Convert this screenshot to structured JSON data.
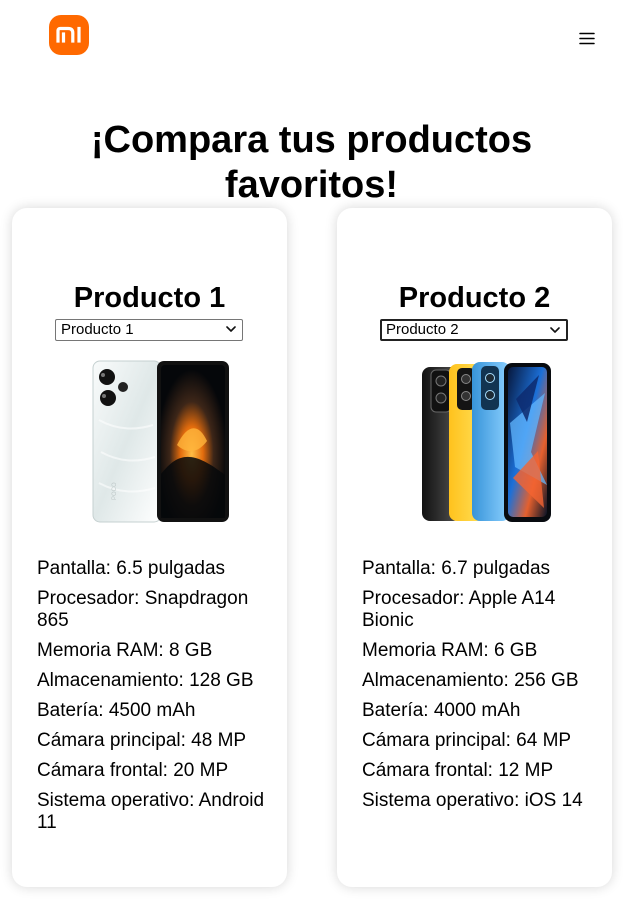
{
  "brand": {
    "logo_text": "mi",
    "menu_icon": "hamburger-menu-icon"
  },
  "page": {
    "title": "¡Compara tus productos favoritos!"
  },
  "products": [
    {
      "title": "Producto 1",
      "selected_option": "Producto 1",
      "image_name": "white-smartphone-image",
      "specs": [
        "Pantalla: 6.5 pulgadas",
        "Procesador: Snapdragon 865",
        "Memoria RAM: 8 GB",
        "Almacenamiento: 128 GB",
        "Batería: 4500 mAh",
        "Cámara principal: 48 MP",
        "Cámara frontal: 20 MP",
        "Sistema operativo: Android 11"
      ]
    },
    {
      "title": "Producto 2",
      "selected_option": "Producto 2",
      "image_name": "colorful-smartphones-image",
      "specs": [
        "Pantalla: 6.7 pulgadas",
        "Procesador: Apple A14 Bionic",
        "Memoria RAM: 6 GB",
        "Almacenamiento: 256 GB",
        "Batería: 4000 mAh",
        "Cámara principal: 64 MP",
        "Cámara frontal: 12 MP",
        "Sistema operativo: iOS 14"
      ]
    }
  ],
  "colors": {
    "brand_orange": "#ff6900",
    "card_background": "#ffffff",
    "text": "#000000"
  }
}
